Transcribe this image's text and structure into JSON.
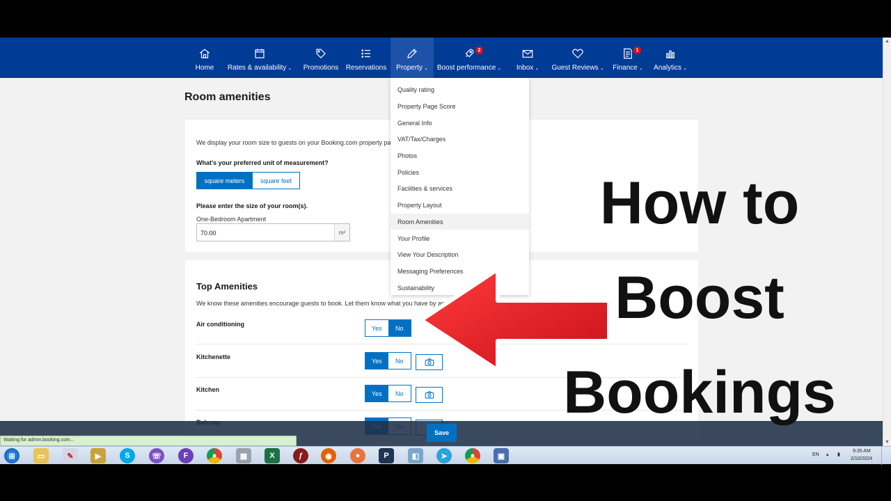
{
  "nav": {
    "items": [
      {
        "label": "Home",
        "chevron": ""
      },
      {
        "label": "Rates & availability",
        "chevron": "⌄"
      },
      {
        "label": "Promotions",
        "chevron": ""
      },
      {
        "label": "Reservations",
        "chevron": ""
      },
      {
        "label": "Property",
        "chevron": "⌄"
      },
      {
        "label": "Boost performance",
        "chevron": "⌄"
      },
      {
        "label": "Inbox",
        "chevron": "⌄"
      },
      {
        "label": "Guest Reviews",
        "chevron": "⌄"
      },
      {
        "label": "Finance",
        "chevron": "⌄"
      },
      {
        "label": "Analytics",
        "chevron": "⌄"
      }
    ],
    "badges": {
      "boost": "2",
      "finance": "1"
    },
    "active": "Property"
  },
  "dropdown": {
    "items": [
      "Quality rating",
      "Property Page Score",
      "General Info",
      "VAT/Tax/Charges",
      "Photos",
      "Policies",
      "Facilities & services",
      "Property Layout",
      "Room Amenities",
      "Your Profile",
      "View Your Description",
      "Messaging Preferences",
      "Sustainability"
    ],
    "highlighted": "Room Amenities"
  },
  "page": {
    "title": "Room amenities",
    "size_card": {
      "intro": "We display your room size to guests on your Booking.com property page.",
      "unit_question": "What's your preferred unit of measurement?",
      "unit_options": [
        "square meters",
        "square feet"
      ],
      "selected_unit": "square meters",
      "size_prompt": "Please enter the size of your room(s).",
      "room_label": "One-Bedroom Apartment",
      "room_value": "70.00",
      "unit_suffix": "m²"
    },
    "amenities_card": {
      "title": "Top Amenities",
      "intro": "We know these amenities encourage guests to book. Let them know what you have by answering the questions below.",
      "yes_label": "Yes",
      "no_label": "No",
      "rows": [
        {
          "name": "Air conditioning",
          "value": "No",
          "photo": false
        },
        {
          "name": "Kitchenette",
          "value": "Yes",
          "photo": true
        },
        {
          "name": "Kitchen",
          "value": "Yes",
          "photo": true
        },
        {
          "name": "Balcony",
          "value": "Yes",
          "photo": true
        }
      ]
    },
    "save_label": "Save",
    "status_text": "Waiting for admin.booking.com..."
  },
  "overlay": {
    "headline": [
      "How to",
      "Boost",
      "Bookings"
    ],
    "arrow_color": "#e8202a"
  },
  "taskbar": {
    "lang": "EN",
    "time": "9:35 AM",
    "date": "2/10/2024"
  },
  "colors": {
    "brand": "#003b95",
    "accent": "#0071c2",
    "badge": "#d4111e"
  }
}
